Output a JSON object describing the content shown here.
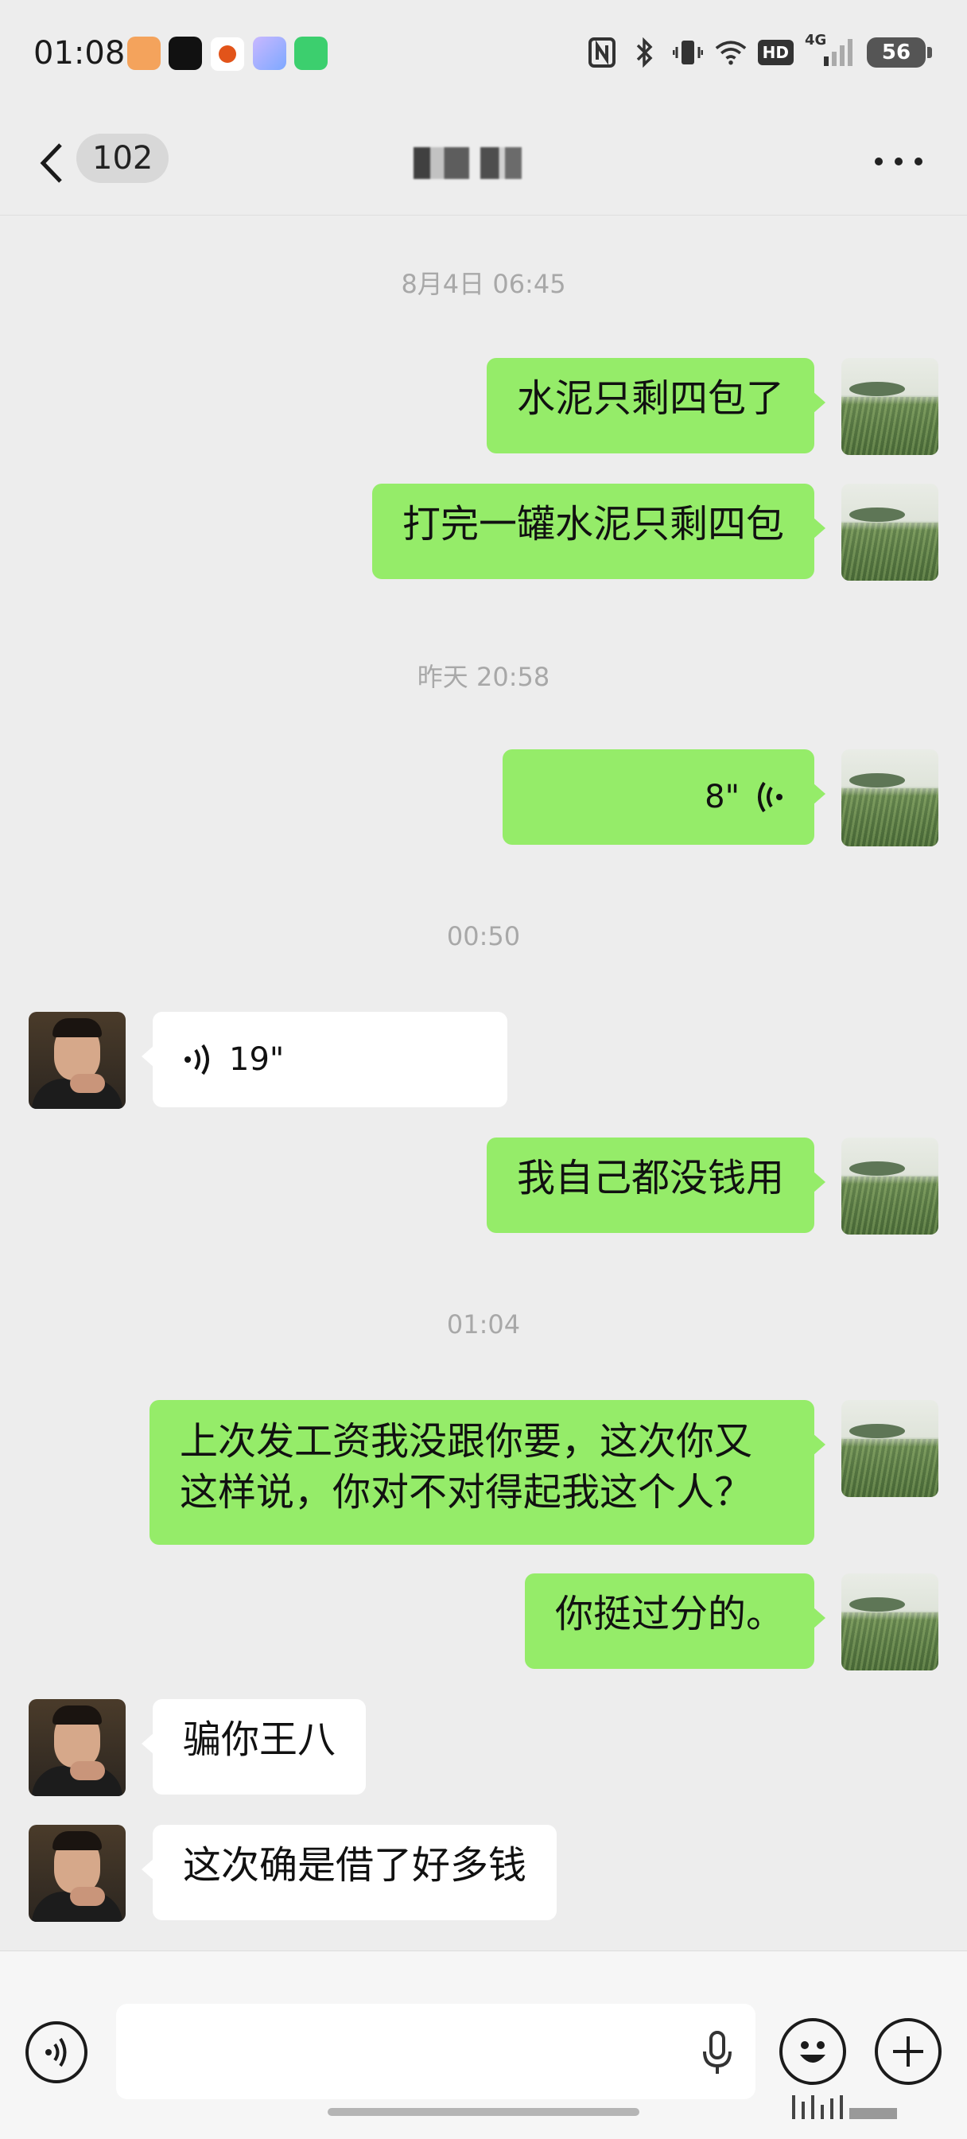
{
  "status_bar": {
    "time": "01:08",
    "battery": "56",
    "network": "4G",
    "hd": "HD"
  },
  "nav": {
    "unread_count": "102",
    "title": "陈  "
  },
  "timestamps": {
    "t1": "8月4日 06:45",
    "t2": "昨天 20:58",
    "t3": "00:50",
    "t4": "01:04"
  },
  "messages": [
    {
      "side": "sent",
      "text": "水泥只剩四包了"
    },
    {
      "side": "sent",
      "text": "打完一罐水泥只剩四包"
    },
    {
      "side": "sent",
      "type": "voice",
      "duration": "8\""
    },
    {
      "side": "received",
      "type": "voice",
      "duration": "19\""
    },
    {
      "side": "sent",
      "text": "我自己都没钱用"
    },
    {
      "side": "sent",
      "text": "上次发工资我没跟你要，这次你又这样说，你对不对得起我这个人？"
    },
    {
      "side": "sent",
      "text": "你挺过分的。"
    },
    {
      "side": "received",
      "text": "骗你王八"
    },
    {
      "side": "received",
      "text": "这次确是借了好多钱"
    }
  ],
  "input": {
    "placeholder": ""
  }
}
